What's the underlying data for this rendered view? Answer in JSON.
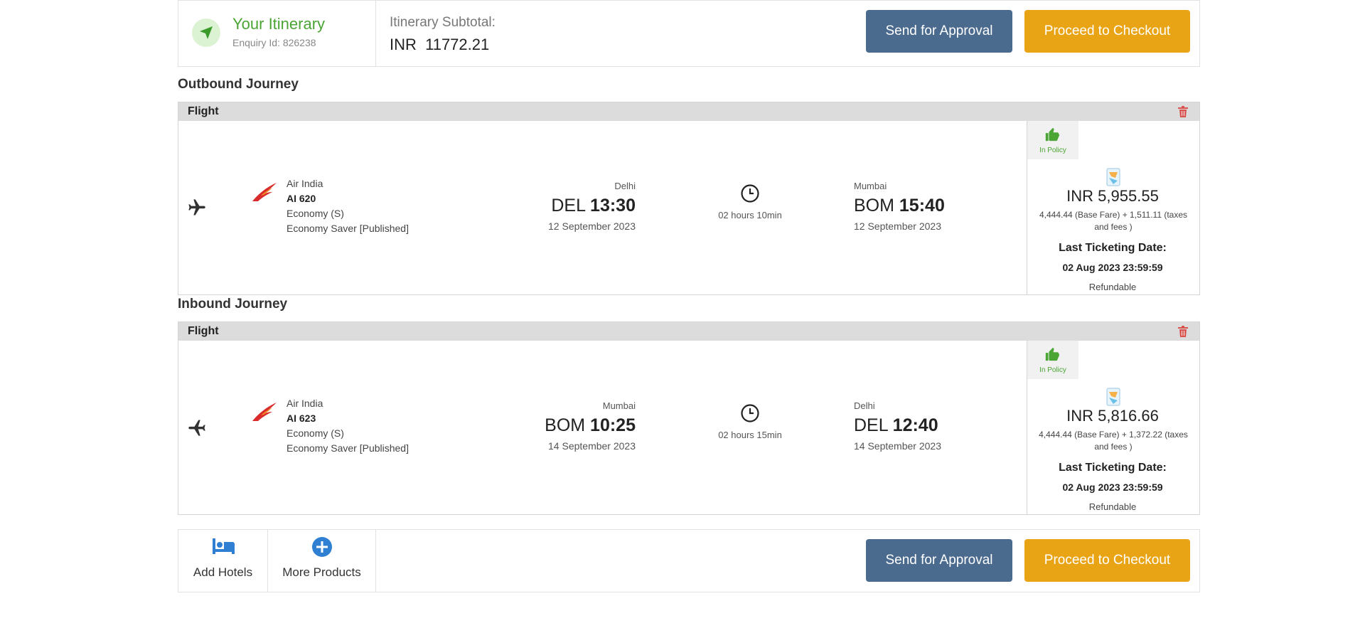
{
  "header": {
    "title": "Your Itinerary",
    "enquiry": "Enquiry Id: 826238",
    "subtotal_label": "Itinerary Subtotal:",
    "subtotal_value": "INR  11772.21",
    "approve_label": "Send for Approval",
    "checkout_label": "Proceed to Checkout"
  },
  "outbound": {
    "section_title": "Outbound Journey",
    "card_label": "Flight",
    "airline": "Air India",
    "flight_no": "AI 620",
    "cabin": "Economy (S)",
    "fare_type": "Economy Saver [Published]",
    "dep_city": "Delhi",
    "dep_code": "DEL",
    "dep_time": "13:30",
    "dep_date": "12 September 2023",
    "duration": "02 hours 10min",
    "arr_city": "Mumbai",
    "arr_code": "BOM",
    "arr_time": "15:40",
    "arr_date": "12 September 2023",
    "policy": "In Policy",
    "total": "INR 5,955.55",
    "breakdown": "4,444.44 (Base Fare) + 1,511.11 (taxes and fees )",
    "ltd_label": "Last Ticketing Date:",
    "ltd_value": "02 Aug 2023 23:59:59",
    "refund": "Refundable"
  },
  "inbound": {
    "section_title": "Inbound Journey",
    "card_label": "Flight",
    "airline": "Air India",
    "flight_no": "AI 623",
    "cabin": "Economy (S)",
    "fare_type": "Economy Saver [Published]",
    "dep_city": "Mumbai",
    "dep_code": "BOM",
    "dep_time": "10:25",
    "dep_date": "14 September 2023",
    "duration": "02 hours 15min",
    "arr_city": "Delhi",
    "arr_code": "DEL",
    "arr_time": "12:40",
    "arr_date": "14 September 2023",
    "policy": "In Policy",
    "total": "INR 5,816.66",
    "breakdown": "4,444.44 (Base Fare) + 1,372.22 (taxes and fees )",
    "ltd_label": "Last Ticketing Date:",
    "ltd_value": "02 Aug 2023 23:59:59",
    "refund": "Refundable"
  },
  "footer": {
    "add_hotels": "Add Hotels",
    "more_products": "More Products",
    "approve_label": "Send for Approval",
    "checkout_label": "Proceed to Checkout"
  },
  "colors": {
    "approve": "#4a6a8e",
    "checkout": "#e8a414",
    "green": "#4aa534",
    "icon_blue": "#2f7fd3",
    "trash_red": "#d9534f"
  },
  "icons": {
    "header": "navigation-arrow-icon",
    "trash": "trash-icon",
    "plane": "airplane-icon",
    "policy": "thumbs-up-icon",
    "clock": "clock-icon",
    "hotel": "bed-icon",
    "more": "plus-circle-icon"
  }
}
